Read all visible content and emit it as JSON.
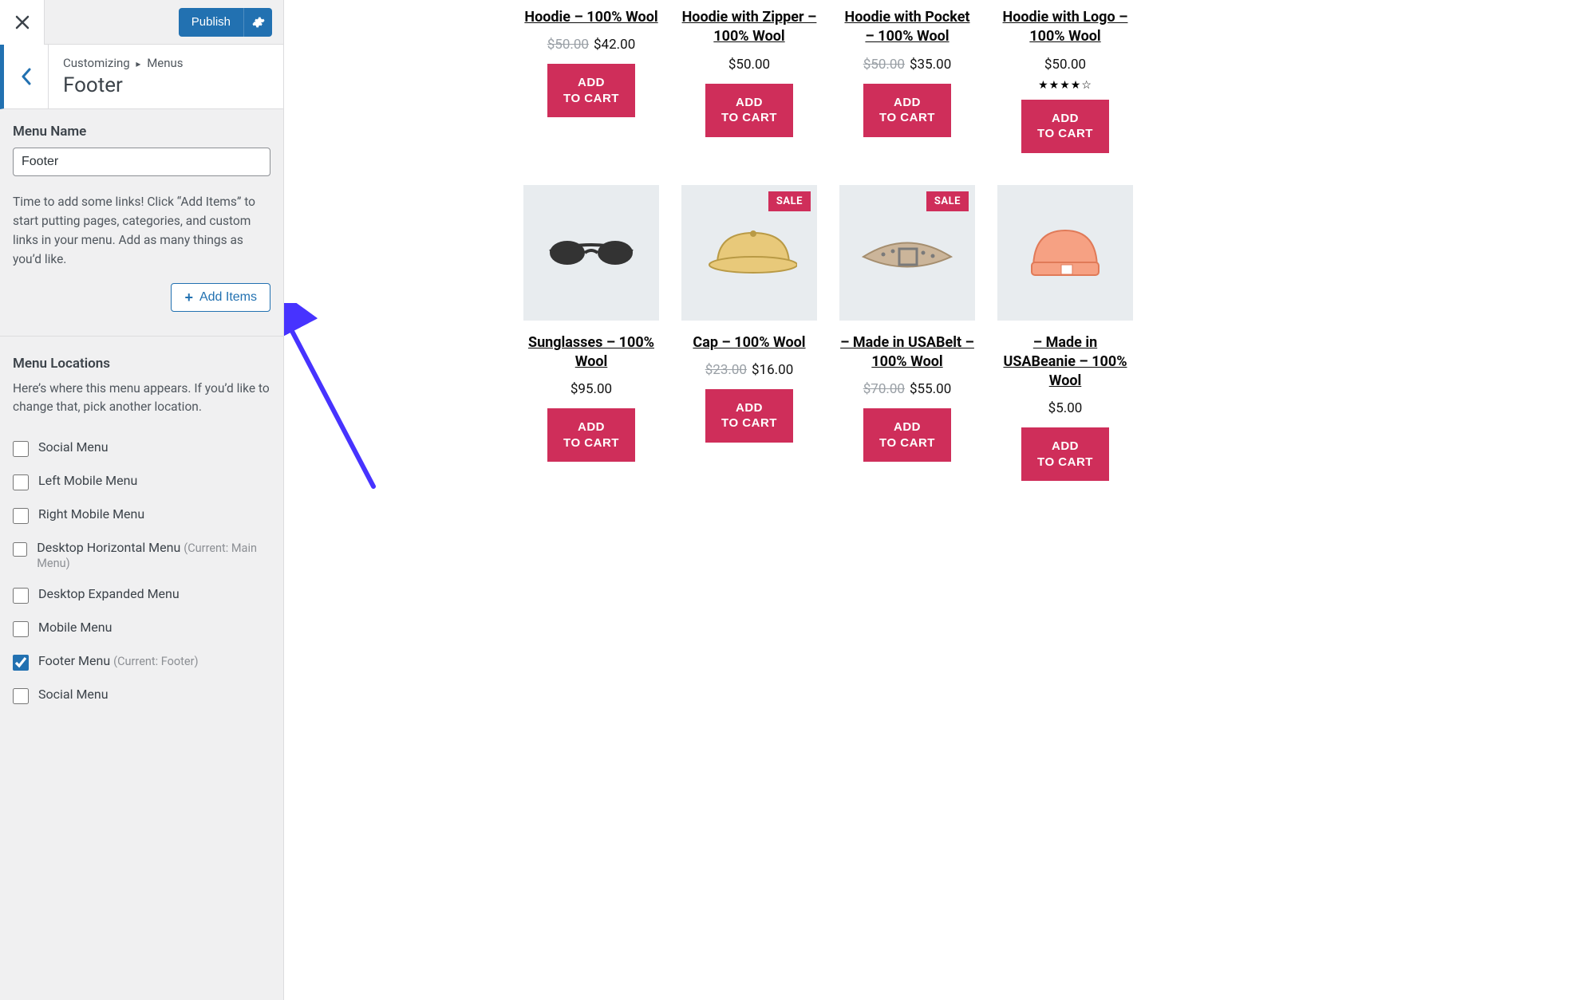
{
  "customizer": {
    "publish_label": "Publish",
    "breadcrumb_prefix": "Customizing",
    "breadcrumb_section": "Menus",
    "breadcrumb_title": "Footer",
    "menu_name_label": "Menu Name",
    "menu_name_value": "Footer",
    "help_text": "Time to add some links! Click “Add Items” to start putting pages, categories, and custom links in your menu. Add as many things as you’d like.",
    "add_items_label": "Add Items",
    "menu_locations_heading": "Menu Locations",
    "menu_locations_help": "Here’s where this menu appears. If you’d like to change that, pick another location.",
    "locations": [
      {
        "label": "Social Menu",
        "suffix": "",
        "checked": false
      },
      {
        "label": "Left Mobile Menu",
        "suffix": "",
        "checked": false
      },
      {
        "label": "Right Mobile Menu",
        "suffix": "",
        "checked": false
      },
      {
        "label": "Desktop Horizontal Menu",
        "suffix": "(Current: Main Menu)",
        "checked": false
      },
      {
        "label": "Desktop Expanded Menu",
        "suffix": "",
        "checked": false
      },
      {
        "label": "Mobile Menu",
        "suffix": "",
        "checked": false
      },
      {
        "label": "Footer Menu",
        "suffix": "(Current: Footer)",
        "checked": true
      },
      {
        "label": "Social Menu",
        "suffix": "",
        "checked": false
      }
    ]
  },
  "shop": {
    "sale_badge": "SALE",
    "add_to_cart": "ADD TO CART",
    "products_row1": [
      {
        "title": "Hoodie – 100% Wool",
        "old_price": "$50.00",
        "price": "$42.00",
        "rating": ""
      },
      {
        "title": "Hoodie with Zipper – 100% Wool",
        "old_price": "",
        "price": "$50.00",
        "rating": ""
      },
      {
        "title": "Hoodie with Pocket – 100% Wool",
        "old_price": "$50.00",
        "price": "$35.00",
        "rating": ""
      },
      {
        "title": "Hoodie with Logo – 100% Wool",
        "old_price": "",
        "price": "$50.00",
        "rating": "★★★★☆"
      }
    ],
    "products_row2": [
      {
        "title": "Sunglasses – 100% Wool",
        "old_price": "",
        "price": "$95.00",
        "sale": false,
        "icon": "sunglasses"
      },
      {
        "title": "Cap – 100% Wool",
        "old_price": "$23.00",
        "price": "$16.00",
        "sale": true,
        "icon": "cap"
      },
      {
        "title": "– Made in USABelt – 100% Wool",
        "old_price": "$70.00",
        "price": "$55.00",
        "sale": true,
        "icon": "belt"
      },
      {
        "title": "– Made in USABeanie – 100% Wool",
        "old_price": "",
        "price": "$5.00",
        "sale": false,
        "icon": "beanie"
      }
    ]
  }
}
